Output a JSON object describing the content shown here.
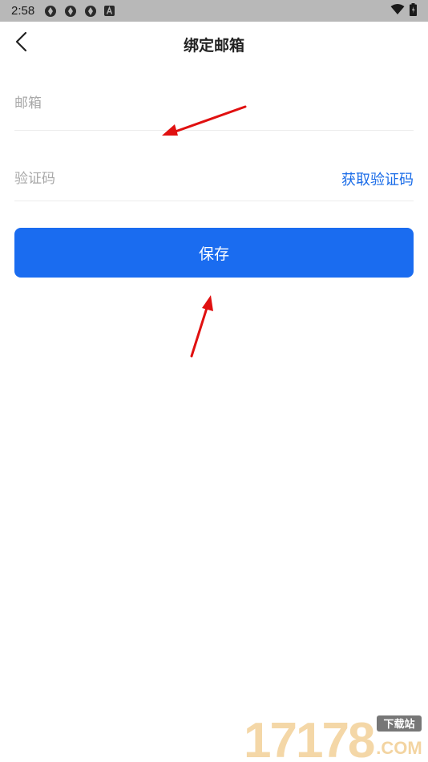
{
  "status_bar": {
    "time": "2:58",
    "left_icons": [
      "aperture-icon",
      "aperture-icon",
      "aperture-icon",
      "a-box-icon"
    ],
    "right_icons": [
      "wifi-icon",
      "battery-icon"
    ]
  },
  "header": {
    "title": "绑定邮箱",
    "back_icon": "chevron-left-icon"
  },
  "form": {
    "email_placeholder": "邮箱",
    "email_value": "",
    "code_placeholder": "验证码",
    "code_value": "",
    "get_code_label": "获取验证码"
  },
  "save_button": {
    "label": "保存",
    "color": "#1a6cf0"
  },
  "annotations": {
    "arrow_color": "#e01010"
  },
  "watermark": {
    "number": "17178",
    "tag": "下载站",
    "domain": ".COM"
  }
}
